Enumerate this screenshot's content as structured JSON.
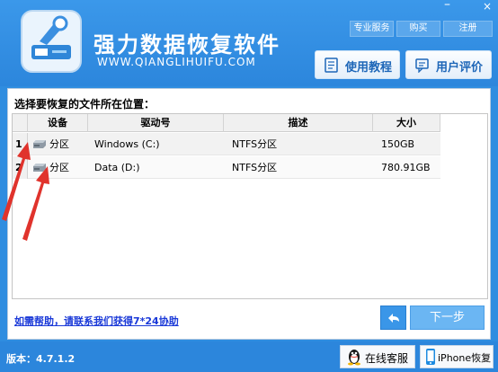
{
  "app": {
    "title": "强力数据恢复软件",
    "url": "WWW.QIANGLIHUIFU.COM"
  },
  "top_buttons": {
    "service": "专业服务",
    "buy": "购买",
    "register": "注册"
  },
  "window_controls": {
    "minimize": "–",
    "close": "×"
  },
  "header_buttons": {
    "tutorial": "使用教程",
    "reviews": "用户评价"
  },
  "prompt": "选择要恢复的文件所在位置：",
  "table": {
    "columns": [
      "设备",
      "驱动号",
      "描述",
      "大小"
    ],
    "rows": [
      {
        "num": "1",
        "device": "分区",
        "drive": "Windows (C:)",
        "desc": "NTFS分区",
        "size": "150GB"
      },
      {
        "num": "2",
        "device": "分区",
        "drive": "Data (D:)",
        "desc": "NTFS分区",
        "size": "780.91GB"
      }
    ]
  },
  "help_link": "如需帮助，请联系我们获得7*24协助",
  "nav": {
    "back": "↶",
    "next": "下一步"
  },
  "footer": {
    "version": "版本：4.7.1.2",
    "online_service": "在线客服",
    "iphone_recovery": "iPhone恢复"
  },
  "colors": {
    "brand_blue": "#2c86dc",
    "next_button": "#6bb6f3",
    "annotation_red": "#e0332c",
    "help_link": "#1a39d8"
  }
}
